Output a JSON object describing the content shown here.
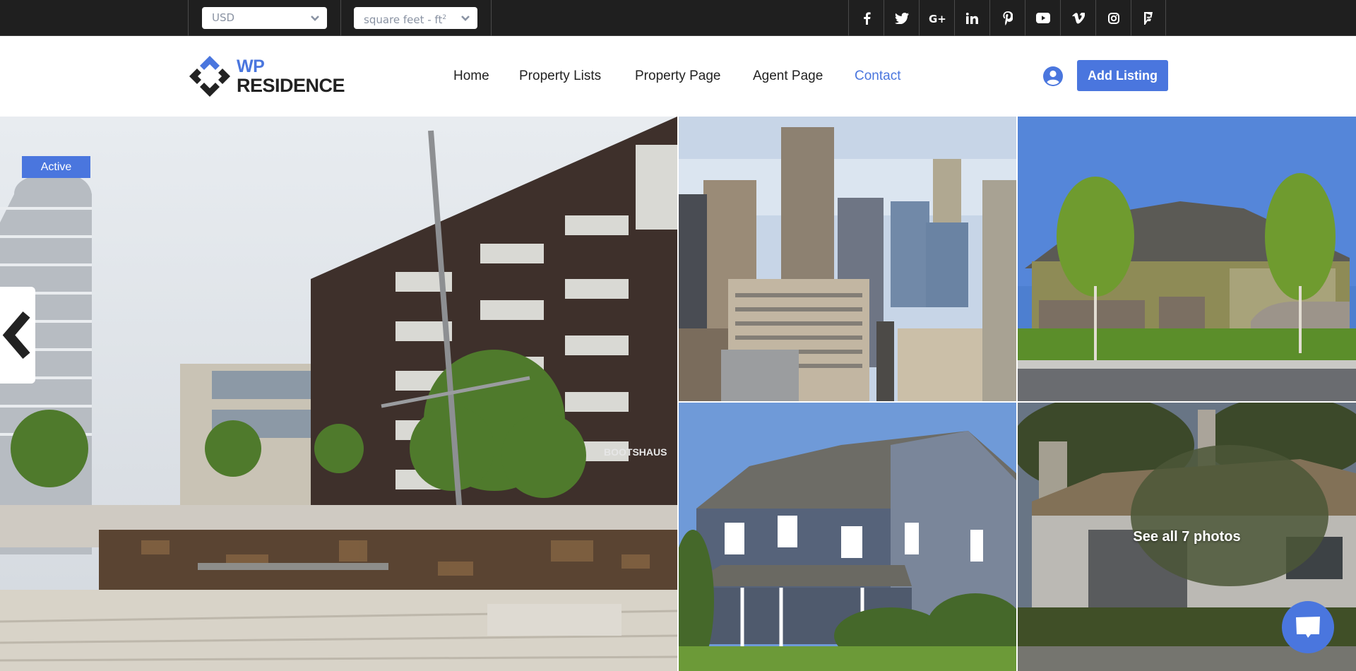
{
  "topbar": {
    "currency": {
      "selected": "USD"
    },
    "units": {
      "selected": "square feet - ft",
      "superscript": "2"
    },
    "social_links": [
      {
        "name": "facebook-icon",
        "label": "Facebook"
      },
      {
        "name": "twitter-icon",
        "label": "Twitter"
      },
      {
        "name": "google-plus-icon",
        "label": "Google+"
      },
      {
        "name": "linkedin-icon",
        "label": "LinkedIn"
      },
      {
        "name": "pinterest-icon",
        "label": "Pinterest"
      },
      {
        "name": "youtube-icon",
        "label": "YouTube"
      },
      {
        "name": "vimeo-icon",
        "label": "Vimeo"
      },
      {
        "name": "instagram-icon",
        "label": "Instagram"
      },
      {
        "name": "foursquare-icon",
        "label": "Foursquare"
      }
    ]
  },
  "header": {
    "logo": {
      "line1": "WP",
      "line2": "RESIDENCE"
    },
    "nav": [
      {
        "label": "Home",
        "active": false
      },
      {
        "label": "Property Lists",
        "active": false
      },
      {
        "label": "Property Page",
        "active": false
      },
      {
        "label": "Agent Page",
        "active": false
      },
      {
        "label": "Contact",
        "active": true
      }
    ],
    "add_listing_label": "Add Listing"
  },
  "gallery": {
    "status_badge": "Active",
    "see_all_label": "See all 7 photos",
    "photos": [
      {
        "name": "photo-modern-apartments",
        "subject": "Modern apartment buildings with balconies"
      },
      {
        "name": "photo-city-skyline",
        "subject": "City skyscrapers aerial view"
      },
      {
        "name": "photo-suburban-house",
        "subject": "Suburban house with trees"
      },
      {
        "name": "photo-blue-house",
        "subject": "Blue two-story house"
      },
      {
        "name": "photo-mediterranean-house",
        "subject": "Mediterranean house with tile roof"
      }
    ],
    "photo_overlay_text": "BOOTSHAUS"
  },
  "colors": {
    "accent": "#4a76de",
    "topbar_bg": "#1f1f1f",
    "text_dark": "#222222"
  }
}
